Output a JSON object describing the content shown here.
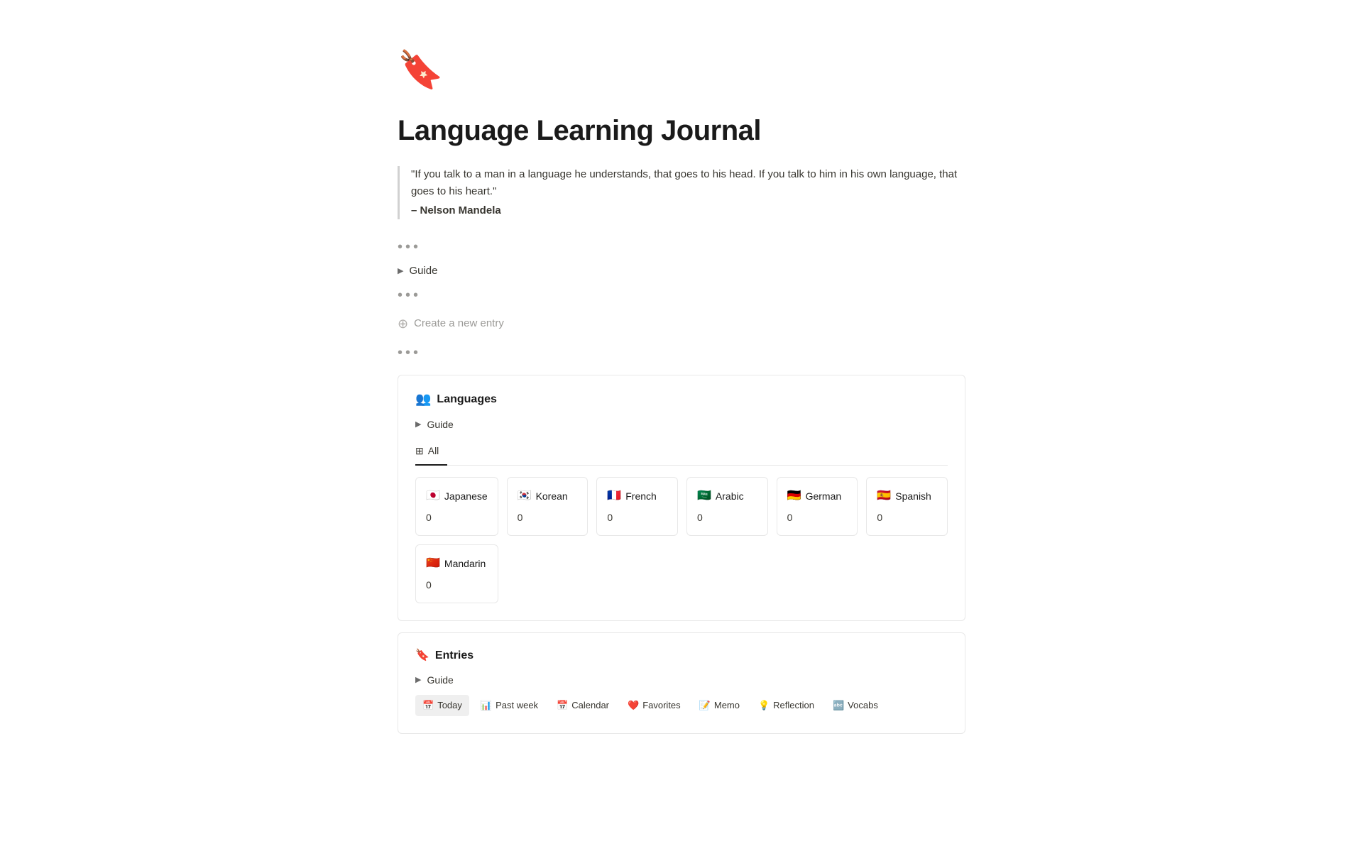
{
  "page": {
    "icon": "🔖",
    "title": "Language Learning Journal",
    "quote": {
      "text": "\"If you talk to a man in a language he understands, that goes to his head. If you talk to him in his own language, that goes to his heart.\"",
      "author": "– Nelson Mandela"
    },
    "dots1": "•••",
    "guide1": {
      "label": "Guide",
      "arrow": "▶"
    },
    "dots2": "•••",
    "create_entry": {
      "label": "Create a new entry",
      "plus": "⊕"
    },
    "dots3": "•••"
  },
  "languages_db": {
    "icon": "👥",
    "title": "Languages",
    "guide": {
      "label": "Guide",
      "arrow": "▶"
    },
    "tabs": [
      {
        "id": "all",
        "icon": "⊞",
        "label": "All",
        "active": true
      }
    ],
    "cards": [
      {
        "flag": "🇯🇵",
        "name": "Japanese",
        "count": "0"
      },
      {
        "flag": "🇰🇷",
        "name": "Korean",
        "count": "0"
      },
      {
        "flag": "🇫🇷",
        "name": "French",
        "count": "0"
      },
      {
        "flag": "🇸🇦",
        "name": "Arabic",
        "count": "0"
      },
      {
        "flag": "🇩🇪",
        "name": "German",
        "count": "0"
      },
      {
        "flag": "🇪🇸",
        "name": "Spanish",
        "count": "0"
      },
      {
        "flag": "🇨🇳",
        "name": "Mandarin",
        "count": "0"
      }
    ]
  },
  "entries_db": {
    "icon": "🔖",
    "title": "Entries",
    "guide": {
      "label": "Guide",
      "arrow": "▶"
    },
    "tabs": [
      {
        "id": "today",
        "icon": "📅",
        "label": "Today",
        "active": true
      },
      {
        "id": "past-week",
        "icon": "📊",
        "label": "Past week",
        "active": false
      },
      {
        "id": "calendar",
        "icon": "📅",
        "label": "Calendar",
        "active": false
      },
      {
        "id": "favorites",
        "icon": "❤️",
        "label": "Favorites",
        "active": false
      },
      {
        "id": "memo",
        "icon": "📝",
        "label": "Memo",
        "active": false
      },
      {
        "id": "reflection",
        "icon": "💡",
        "label": "Reflection",
        "active": false
      },
      {
        "id": "vocabs",
        "icon": "🔤",
        "label": "Vocabs",
        "active": false
      }
    ]
  }
}
